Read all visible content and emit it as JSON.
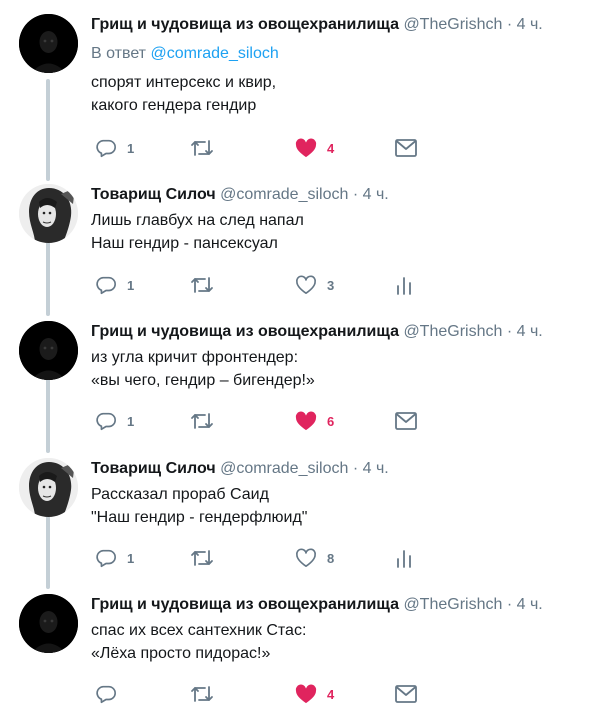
{
  "tweets": [
    {
      "name": "Грищ и чудовища из овощехранилища",
      "handle": "@TheGrishch",
      "sep": "·",
      "time": "4 ч.",
      "reply_prefix": "В ответ ",
      "reply_to": "@comrade_siloch",
      "text": "спорят интерсекс и квир,\nкакого гендера гендир",
      "replies": "1",
      "retweets": "",
      "likes": "4",
      "liked": true,
      "last_icon": "mail-icon"
    },
    {
      "name": "Товарищ Силоч",
      "handle": "@comrade_siloch",
      "sep": "·",
      "time": "4 ч.",
      "text": "Лишь главбух на след напал\nНаш гендир - пансексуал",
      "replies": "1",
      "retweets": "",
      "likes": "3",
      "liked": false,
      "last_icon": "analytics-icon"
    },
    {
      "name": "Грищ и чудовища из овощехранилища",
      "handle": "@TheGrishch",
      "sep": "·",
      "time": "4 ч.",
      "text": "из угла кричит фронтендер:\n«вы чего, гендир – бигендер!»",
      "replies": "1",
      "retweets": "",
      "likes": "6",
      "liked": true,
      "last_icon": "mail-icon"
    },
    {
      "name": "Товарищ Силоч",
      "handle": "@comrade_siloch",
      "sep": "·",
      "time": "4 ч.",
      "text": "Рассказал прораб Саид\n\"Наш гендир - гендерфлюид\"",
      "replies": "1",
      "retweets": "",
      "likes": "8",
      "liked": false,
      "last_icon": "analytics-icon"
    },
    {
      "name": "Грищ и чудовища из овощехранилища",
      "handle": "@TheGrishch",
      "sep": "·",
      "time": "4 ч.",
      "text": "спас их всех сантехник Стас:\n«Лёха просто пидорас!»",
      "replies": "",
      "retweets": "",
      "likes": "4",
      "liked": true,
      "last_icon": "mail-icon"
    }
  ],
  "colors": {
    "like_active": "#e0245e",
    "icon_gray": "#657786",
    "link": "#1da1f2",
    "thread_line": "#c4cfd6"
  }
}
